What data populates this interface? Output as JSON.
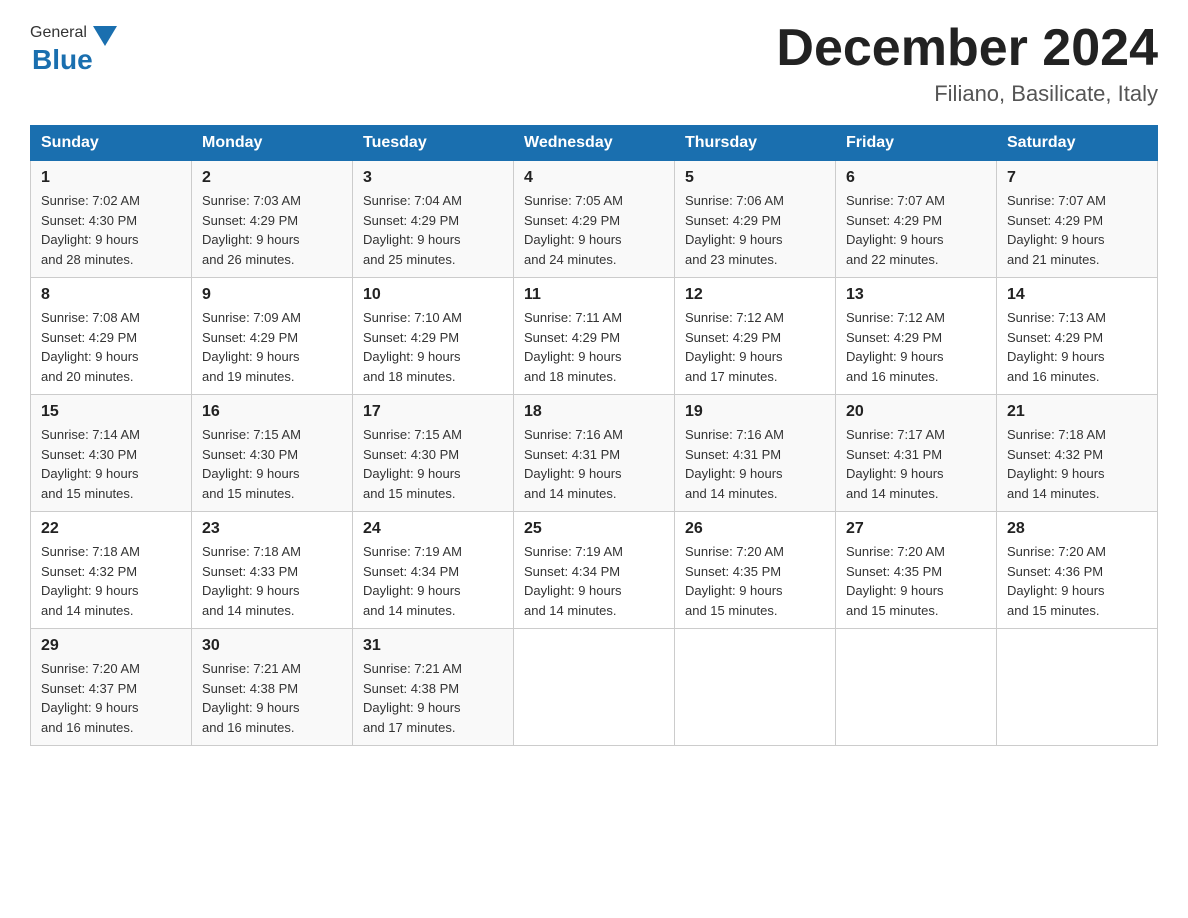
{
  "header": {
    "logo": {
      "general": "General",
      "blue": "Blue"
    },
    "month_year": "December 2024",
    "location": "Filiano, Basilicate, Italy"
  },
  "days_of_week": [
    "Sunday",
    "Monday",
    "Tuesday",
    "Wednesday",
    "Thursday",
    "Friday",
    "Saturday"
  ],
  "weeks": [
    [
      {
        "day": "1",
        "sunrise": "7:02 AM",
        "sunset": "4:30 PM",
        "daylight": "9 hours and 28 minutes."
      },
      {
        "day": "2",
        "sunrise": "7:03 AM",
        "sunset": "4:29 PM",
        "daylight": "9 hours and 26 minutes."
      },
      {
        "day": "3",
        "sunrise": "7:04 AM",
        "sunset": "4:29 PM",
        "daylight": "9 hours and 25 minutes."
      },
      {
        "day": "4",
        "sunrise": "7:05 AM",
        "sunset": "4:29 PM",
        "daylight": "9 hours and 24 minutes."
      },
      {
        "day": "5",
        "sunrise": "7:06 AM",
        "sunset": "4:29 PM",
        "daylight": "9 hours and 23 minutes."
      },
      {
        "day": "6",
        "sunrise": "7:07 AM",
        "sunset": "4:29 PM",
        "daylight": "9 hours and 22 minutes."
      },
      {
        "day": "7",
        "sunrise": "7:07 AM",
        "sunset": "4:29 PM",
        "daylight": "9 hours and 21 minutes."
      }
    ],
    [
      {
        "day": "8",
        "sunrise": "7:08 AM",
        "sunset": "4:29 PM",
        "daylight": "9 hours and 20 minutes."
      },
      {
        "day": "9",
        "sunrise": "7:09 AM",
        "sunset": "4:29 PM",
        "daylight": "9 hours and 19 minutes."
      },
      {
        "day": "10",
        "sunrise": "7:10 AM",
        "sunset": "4:29 PM",
        "daylight": "9 hours and 18 minutes."
      },
      {
        "day": "11",
        "sunrise": "7:11 AM",
        "sunset": "4:29 PM",
        "daylight": "9 hours and 18 minutes."
      },
      {
        "day": "12",
        "sunrise": "7:12 AM",
        "sunset": "4:29 PM",
        "daylight": "9 hours and 17 minutes."
      },
      {
        "day": "13",
        "sunrise": "7:12 AM",
        "sunset": "4:29 PM",
        "daylight": "9 hours and 16 minutes."
      },
      {
        "day": "14",
        "sunrise": "7:13 AM",
        "sunset": "4:29 PM",
        "daylight": "9 hours and 16 minutes."
      }
    ],
    [
      {
        "day": "15",
        "sunrise": "7:14 AM",
        "sunset": "4:30 PM",
        "daylight": "9 hours and 15 minutes."
      },
      {
        "day": "16",
        "sunrise": "7:15 AM",
        "sunset": "4:30 PM",
        "daylight": "9 hours and 15 minutes."
      },
      {
        "day": "17",
        "sunrise": "7:15 AM",
        "sunset": "4:30 PM",
        "daylight": "9 hours and 15 minutes."
      },
      {
        "day": "18",
        "sunrise": "7:16 AM",
        "sunset": "4:31 PM",
        "daylight": "9 hours and 14 minutes."
      },
      {
        "day": "19",
        "sunrise": "7:16 AM",
        "sunset": "4:31 PM",
        "daylight": "9 hours and 14 minutes."
      },
      {
        "day": "20",
        "sunrise": "7:17 AM",
        "sunset": "4:31 PM",
        "daylight": "9 hours and 14 minutes."
      },
      {
        "day": "21",
        "sunrise": "7:18 AM",
        "sunset": "4:32 PM",
        "daylight": "9 hours and 14 minutes."
      }
    ],
    [
      {
        "day": "22",
        "sunrise": "7:18 AM",
        "sunset": "4:32 PM",
        "daylight": "9 hours and 14 minutes."
      },
      {
        "day": "23",
        "sunrise": "7:18 AM",
        "sunset": "4:33 PM",
        "daylight": "9 hours and 14 minutes."
      },
      {
        "day": "24",
        "sunrise": "7:19 AM",
        "sunset": "4:34 PM",
        "daylight": "9 hours and 14 minutes."
      },
      {
        "day": "25",
        "sunrise": "7:19 AM",
        "sunset": "4:34 PM",
        "daylight": "9 hours and 14 minutes."
      },
      {
        "day": "26",
        "sunrise": "7:20 AM",
        "sunset": "4:35 PM",
        "daylight": "9 hours and 15 minutes."
      },
      {
        "day": "27",
        "sunrise": "7:20 AM",
        "sunset": "4:35 PM",
        "daylight": "9 hours and 15 minutes."
      },
      {
        "day": "28",
        "sunrise": "7:20 AM",
        "sunset": "4:36 PM",
        "daylight": "9 hours and 15 minutes."
      }
    ],
    [
      {
        "day": "29",
        "sunrise": "7:20 AM",
        "sunset": "4:37 PM",
        "daylight": "9 hours and 16 minutes."
      },
      {
        "day": "30",
        "sunrise": "7:21 AM",
        "sunset": "4:38 PM",
        "daylight": "9 hours and 16 minutes."
      },
      {
        "day": "31",
        "sunrise": "7:21 AM",
        "sunset": "4:38 PM",
        "daylight": "9 hours and 17 minutes."
      },
      null,
      null,
      null,
      null
    ]
  ],
  "labels": {
    "sunrise": "Sunrise:",
    "sunset": "Sunset:",
    "daylight": "Daylight:"
  }
}
